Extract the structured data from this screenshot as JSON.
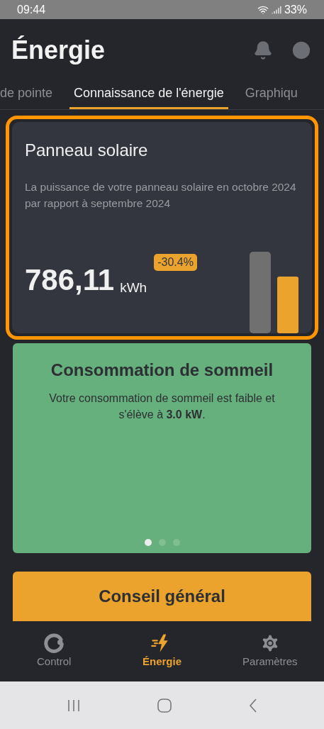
{
  "status_bar": {
    "time": "09:44",
    "battery": "33%"
  },
  "header": {
    "title": "Énergie"
  },
  "tabs": [
    {
      "label": "de pointe",
      "selected": false
    },
    {
      "label": "Connaissance de l'énergie",
      "selected": true
    },
    {
      "label": "Graphiqu",
      "selected": false
    }
  ],
  "solar_card": {
    "highlighted": true,
    "title": "Panneau solaire",
    "description": "La puissance de votre panneau solaire en octobre 2024 par rapport à septembre 2024",
    "value": "786,11",
    "unit": "kWh",
    "change": "-30.4%"
  },
  "sleep_card": {
    "title": "Consommation de sommeil",
    "text": "Votre consommation de sommeil est faible et s'élève à **3.0 kW**.",
    "dots": [
      {
        "selected": true
      },
      {
        "selected": false
      },
      {
        "selected": false
      }
    ]
  },
  "advice_button": {
    "label": "Conseil général"
  },
  "bottom_nav": [
    {
      "kind": "control",
      "label": "Control",
      "selected": false
    },
    {
      "kind": "energy",
      "label": "Énergie",
      "selected": true
    },
    {
      "kind": "settings",
      "label": "Paramètres",
      "selected": false
    }
  ]
}
